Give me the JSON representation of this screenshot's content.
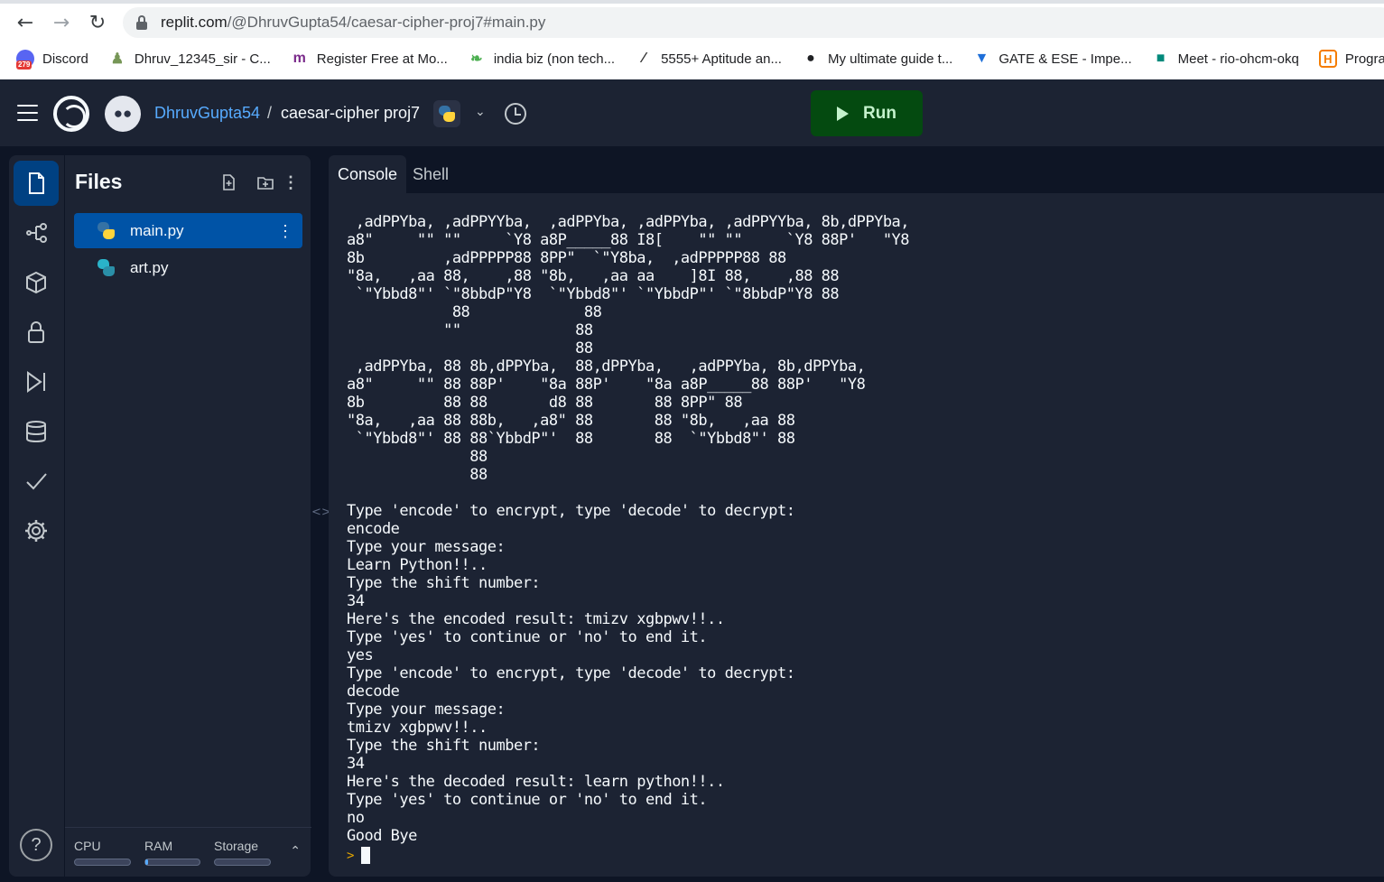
{
  "browser": {
    "url_host": "replit.com",
    "url_path": "/@DhruvGupta54/caesar-cipher-proj7#main.py",
    "bookmarks": [
      {
        "label": "Discord",
        "icon": "discord-icon",
        "color": "#5865f2"
      },
      {
        "label": "Dhruv_12345_sir - C...",
        "icon": "chess-pawn-icon",
        "color": "#769656"
      },
      {
        "label": "Register Free at Mo...",
        "icon": "m-logo-icon",
        "color": "#7a2a8a"
      },
      {
        "label": "india biz (non tech...",
        "icon": "grasshopper-icon",
        "color": "#4caf50"
      },
      {
        "label": "5555+ Aptitude an...",
        "icon": "indiabix-icon",
        "color": "#333333"
      },
      {
        "label": "My ultimate guide t...",
        "icon": "globe-icon",
        "color": "#202124"
      },
      {
        "label": "GATE & ESE - Impe...",
        "icon": "gate-icon",
        "color": "#1e6fd9"
      },
      {
        "label": "Meet - rio-ohcm-okq",
        "icon": "google-meet-icon",
        "color": "#00897b"
      },
      {
        "label": "Programm",
        "icon": "h-logo-icon",
        "color": "#f57c00"
      }
    ],
    "discord_badge": "279"
  },
  "repl": {
    "owner": "DhruvGupta54",
    "separator": "/",
    "name": "caesar-cipher proj7",
    "language_icon": "python-icon",
    "run_label": "Run"
  },
  "sidebar": {
    "items": [
      {
        "name": "files",
        "icon": "files-icon",
        "active": true
      },
      {
        "name": "version-control",
        "icon": "git-branch-icon",
        "active": false
      },
      {
        "name": "packages",
        "icon": "package-cube-icon",
        "active": false
      },
      {
        "name": "secrets",
        "icon": "lock-icon",
        "active": false
      },
      {
        "name": "debugger",
        "icon": "debugger-icon",
        "active": false
      },
      {
        "name": "database",
        "icon": "database-icon",
        "active": false
      },
      {
        "name": "unit-tests",
        "icon": "check-icon",
        "active": false
      },
      {
        "name": "settings",
        "icon": "gear-icon",
        "active": false
      }
    ],
    "help_label": "?"
  },
  "files": {
    "title": "Files",
    "items": [
      {
        "name": "main.py",
        "selected": true
      },
      {
        "name": "art.py",
        "selected": false
      }
    ],
    "resources": {
      "cpu_label": "CPU",
      "ram_label": "RAM",
      "storage_label": "Storage",
      "cpu_level": 0.0,
      "ram_level": 0.05,
      "storage_level": 0.0
    }
  },
  "tabs": {
    "console": "Console",
    "shell": "Shell"
  },
  "console": {
    "output": " ,adPPYba, ,adPPYYba,  ,adPPYba, ,adPPYba, ,adPPYYba, 8b,dPPYba,\na8\"     \"\" \"\"     `Y8 a8P_____88 I8[    \"\" \"\"     `Y8 88P'   \"Y8\n8b         ,adPPPPP88 8PP\"  `\"Y8ba,  ,adPPPPP88 88\n\"8a,   ,aa 88,    ,88 \"8b,   ,aa aa    ]8I 88,    ,88 88\n `\"Ybbd8\"' `\"8bbdP\"Y8  `\"Ybbd8\"' `\"YbbdP\"' `\"8bbdP\"Y8 88\n            88             88\n           \"\"             88\n                          88\n ,adPPYba, 88 8b,dPPYba,  88,dPPYba,   ,adPPYba, 8b,dPPYba,\na8\"     \"\" 88 88P'    \"8a 88P'    \"8a a8P_____88 88P'   \"Y8\n8b         88 88       d8 88       88 8PP\" 88\n\"8a,   ,aa 88 88b,   ,a8\" 88       88 \"8b,   ,aa 88\n `\"Ybbd8\"' 88 88`YbbdP\"'  88       88  `\"Ybbd8\"' 88\n              88\n              88\n\nType 'encode' to encrypt, type 'decode' to decrypt:\nencode\nType your message:\nLearn Python!!..\nType the shift number:\n34\nHere's the encoded result: tmizv xgbpwv!!..\nType 'yes' to continue or 'no' to end it.\nyes\nType 'encode' to encrypt, type 'decode' to decrypt:\ndecode\nType your message:\ntmizv xgbpwv!!..\nType the shift number:\n34\nHere's the decoded result: learn python!!..\nType 'yes' to continue or 'no' to end it.\nno\nGood Bye",
    "prompt_symbol": ">"
  },
  "colors": {
    "accent": "#0079f2",
    "run_bg": "#044a10",
    "run_fg": "#c4f2cc",
    "owner_link": "#57abff",
    "panel_bg": "#1c2333",
    "app_bg": "#0e1525"
  }
}
